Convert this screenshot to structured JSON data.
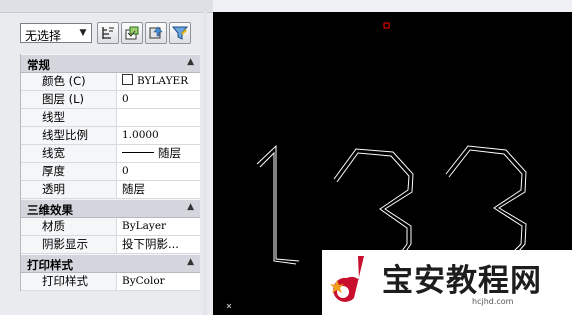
{
  "toolbar": {
    "selection": "无选择",
    "buttons": [
      "toggle-pickadd-icon",
      "select-objects-icon",
      "quick-select-icon",
      "filter-icon"
    ]
  },
  "sections": [
    {
      "title": "常规",
      "rows": [
        {
          "key": "颜色 (C)",
          "value": "BYLAYER"
        },
        {
          "key": "图层 (L)",
          "value": "0"
        },
        {
          "key": "线型",
          "value": ""
        },
        {
          "key": "线型比例",
          "value": "1.0000"
        },
        {
          "key": "线宽",
          "value": "随层"
        },
        {
          "key": "厚度",
          "value": "0"
        },
        {
          "key": "透明",
          "value": "随层"
        }
      ]
    },
    {
      "title": "三维效果",
      "rows": [
        {
          "key": "材质",
          "value": "ByLayer"
        },
        {
          "key": "阴影显示",
          "value": "投下阴影..."
        }
      ]
    },
    {
      "title": "打印样式",
      "rows": [
        {
          "key": "打印样式",
          "value": "ByColor"
        }
      ]
    }
  ],
  "colors": {
    "canvas": "#000000",
    "geometry": "#ffffff",
    "grip": "#ff0000",
    "watermark_logo": "#c8102e"
  },
  "watermark": {
    "name": "宝安教程网",
    "url": "hcjhd.com"
  }
}
